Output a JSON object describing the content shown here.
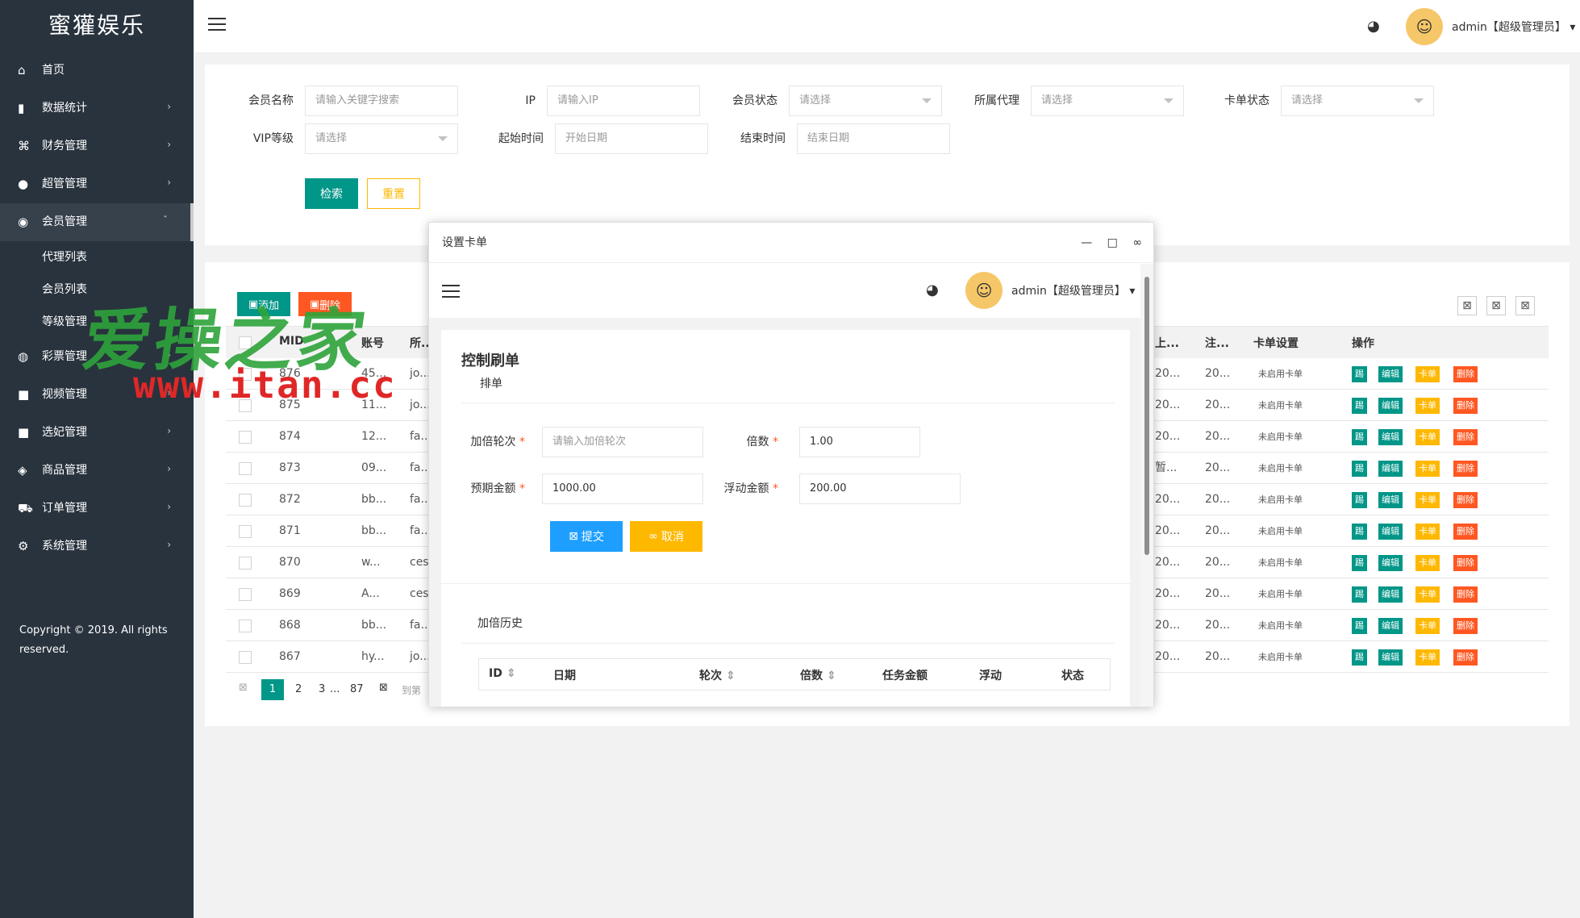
{
  "sidebar": {
    "logo": "蜜獾娱乐",
    "items": [
      {
        "label": "首页",
        "icon": "home-icon",
        "glyph": "⌂",
        "arrow": ""
      },
      {
        "label": "数据统计",
        "icon": "bar-chart-icon",
        "glyph": "▮",
        "arrow": "›"
      },
      {
        "label": "财务管理",
        "icon": "bank-icon",
        "glyph": "⌘",
        "arrow": "›"
      },
      {
        "label": "超管管理",
        "icon": "user-icon",
        "glyph": "●",
        "arrow": "›"
      },
      {
        "label": "会员管理",
        "icon": "users-icon",
        "glyph": "◉",
        "arrow": "ˇ"
      }
    ],
    "sub_items": [
      "代理列表",
      "会员列表",
      "等级管理"
    ],
    "items2": [
      {
        "label": "彩票管理",
        "icon": "gamepad-icon",
        "glyph": "◍",
        "arrow": "›"
      },
      {
        "label": "视频管理",
        "icon": "video-icon",
        "glyph": "■",
        "arrow": "›"
      },
      {
        "label": "选妃管理",
        "icon": "camera-icon",
        "glyph": "■",
        "arrow": "›"
      },
      {
        "label": "商品管理",
        "icon": "cube-icon",
        "glyph": "◈",
        "arrow": "›"
      },
      {
        "label": "订单管理",
        "icon": "cart-icon",
        "glyph": "⛟",
        "arrow": "›"
      },
      {
        "label": "系统管理",
        "icon": "gear-icon",
        "glyph": "⚙",
        "arrow": "›"
      }
    ],
    "copyright": "Copyright © 2019. All rights reserved."
  },
  "topbar": {
    "user": "admin【超级管理员】",
    "user_caret": "▾"
  },
  "filters": {
    "member_name_label": "会员名称",
    "member_name_ph": "请输入关键字搜索",
    "ip_label": "IP",
    "ip_ph": "请输入IP",
    "status_label": "会员状态",
    "status_ph": "请选择",
    "agent_label": "所属代理",
    "agent_ph": "请选择",
    "card_status_label": "卡单状态",
    "card_status_ph": "请选择",
    "vip_label": "VIP等级",
    "vip_ph": "请选择",
    "start_label": "起始时间",
    "start_ph": "开始日期",
    "end_label": "结束时间",
    "end_ph": "结束日期",
    "search_btn": "检索",
    "reset_btn": "重置"
  },
  "table": {
    "add_btn": "添加",
    "delete_btn": "删除",
    "headers": {
      "mid": "MID",
      "account": "账号",
      "belong": "所...",
      "last": "上...",
      "reg": "注...",
      "card": "卡单设置",
      "ops": "操作"
    },
    "rows": [
      {
        "mid": "876",
        "acc": "45...",
        "bel": "jo...",
        "last": "20...",
        "reg": "20...",
        "card": "未启用卡单"
      },
      {
        "mid": "875",
        "acc": "11...",
        "bel": "jo...",
        "last": "20...",
        "reg": "20...",
        "card": "未启用卡单"
      },
      {
        "mid": "874",
        "acc": "12...",
        "bel": "fa...",
        "last": "20...",
        "reg": "20...",
        "card": "未启用卡单"
      },
      {
        "mid": "873",
        "acc": "09...",
        "bel": "fa...",
        "last": "暂...",
        "reg": "20...",
        "card": "未启用卡单"
      },
      {
        "mid": "872",
        "acc": "bb...",
        "bel": "fa...",
        "last": "20...",
        "reg": "20...",
        "card": "未启用卡单"
      },
      {
        "mid": "871",
        "acc": "bb...",
        "bel": "fa...",
        "last": "20...",
        "reg": "20...",
        "card": "未启用卡单"
      },
      {
        "mid": "870",
        "acc": "w...",
        "bel": "ces",
        "last": "20...",
        "reg": "20...",
        "card": "未启用卡单"
      },
      {
        "mid": "869",
        "acc": "A...",
        "bel": "ces",
        "last": "20...",
        "reg": "20...",
        "card": "未启用卡单"
      },
      {
        "mid": "868",
        "acc": "bb...",
        "bel": "fa...",
        "last": "20...",
        "reg": "20...",
        "card": "未启用卡单"
      },
      {
        "mid": "867",
        "acc": "hy...",
        "bel": "jo...",
        "last": "20...",
        "reg": "20...",
        "card": "未启用卡单"
      }
    ],
    "ops": {
      "kick": "踢",
      "edit": "编辑",
      "card": "卡单",
      "del": "删除"
    },
    "pager": {
      "p1": "1",
      "p2": "2",
      "p3": "3",
      "ellipsis": "...",
      "last": "87",
      "goto": "到第"
    }
  },
  "watermark": {
    "line1": "爱操之家",
    "line2": "www.itan.cc"
  },
  "modal": {
    "title": "设置卡单",
    "min": "—",
    "max": "□",
    "close": "∞",
    "user": "admin【超级管理员】",
    "heading": "控制刷单",
    "section": "排单",
    "round_label": "加倍轮次",
    "round_ph": "请输入加倍轮次",
    "mult_label": "倍数",
    "mult_val": "1.00",
    "expect_label": "预期金额",
    "expect_val": "1000.00",
    "float_label": "浮动金额",
    "float_val": "200.00",
    "required": "*",
    "submit": "提交",
    "cancel": "取消",
    "history": "加倍历史",
    "h_id": "ID",
    "h_date": "日期",
    "h_round": "轮次",
    "h_mult": "倍数",
    "h_task": "任务金额",
    "h_float": "浮动",
    "h_status": "状态",
    "sort": "⇕"
  },
  "colors": {
    "sidebar": "#28333e",
    "primary": "#009688",
    "danger": "#ff5722",
    "warm": "#ffb800",
    "blue": "#1e9fff"
  }
}
